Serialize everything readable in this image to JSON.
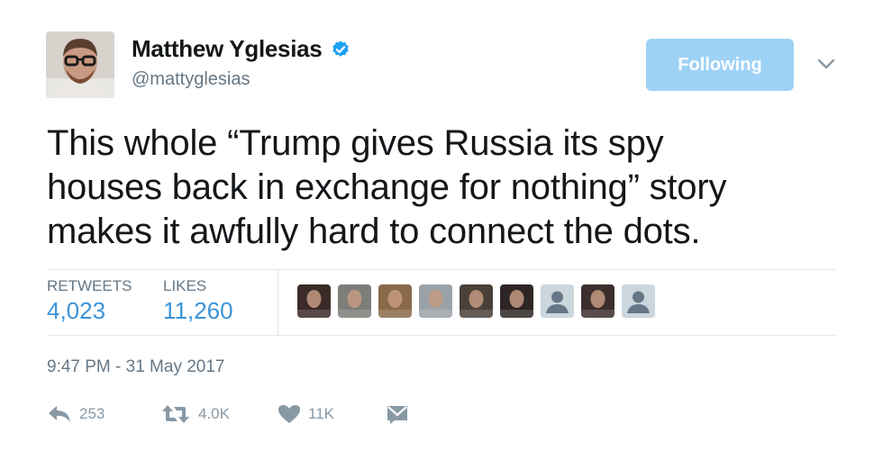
{
  "author": {
    "display_name": "Matthew Yglesias",
    "handle": "@mattyglesias",
    "verified": true
  },
  "follow_button": {
    "label": "Following"
  },
  "tweet": {
    "lines": [
      "This whole “Trump gives Russia its spy",
      "houses back in exchange for nothing” story",
      "makes it awfully hard to connect the dots."
    ]
  },
  "stats": {
    "retweets_label": "RETWEETS",
    "retweets_value": "4,023",
    "likes_label": "LIKES",
    "likes_value": "11,260"
  },
  "likers": [
    {
      "type": "photo",
      "color": "#3a2a28"
    },
    {
      "type": "photo",
      "color": "#7d7d7a"
    },
    {
      "type": "photo",
      "color": "#8a6a48"
    },
    {
      "type": "photo",
      "color": "#9aa2a8"
    },
    {
      "type": "photo",
      "color": "#4a4038"
    },
    {
      "type": "photo",
      "color": "#2e2624"
    },
    {
      "type": "default",
      "color": "#ccd6dd"
    },
    {
      "type": "photo",
      "color": "#3c2e2c"
    },
    {
      "type": "default",
      "color": "#ccd6dd"
    }
  ],
  "timestamp": "9:47 PM - 31 May 2017",
  "actions": {
    "reply_count": "253",
    "retweet_count": "4.0K",
    "like_count": "11K"
  },
  "colors": {
    "link_blue": "#3b94d9",
    "button_blue": "#9fd2f7",
    "muted_gray": "#657786",
    "icon_gray": "#8899a6"
  },
  "icons": [
    "verified-badge-icon",
    "chevron-down-icon",
    "reply-icon",
    "retweet-icon",
    "heart-icon",
    "direct-message-icon"
  ]
}
